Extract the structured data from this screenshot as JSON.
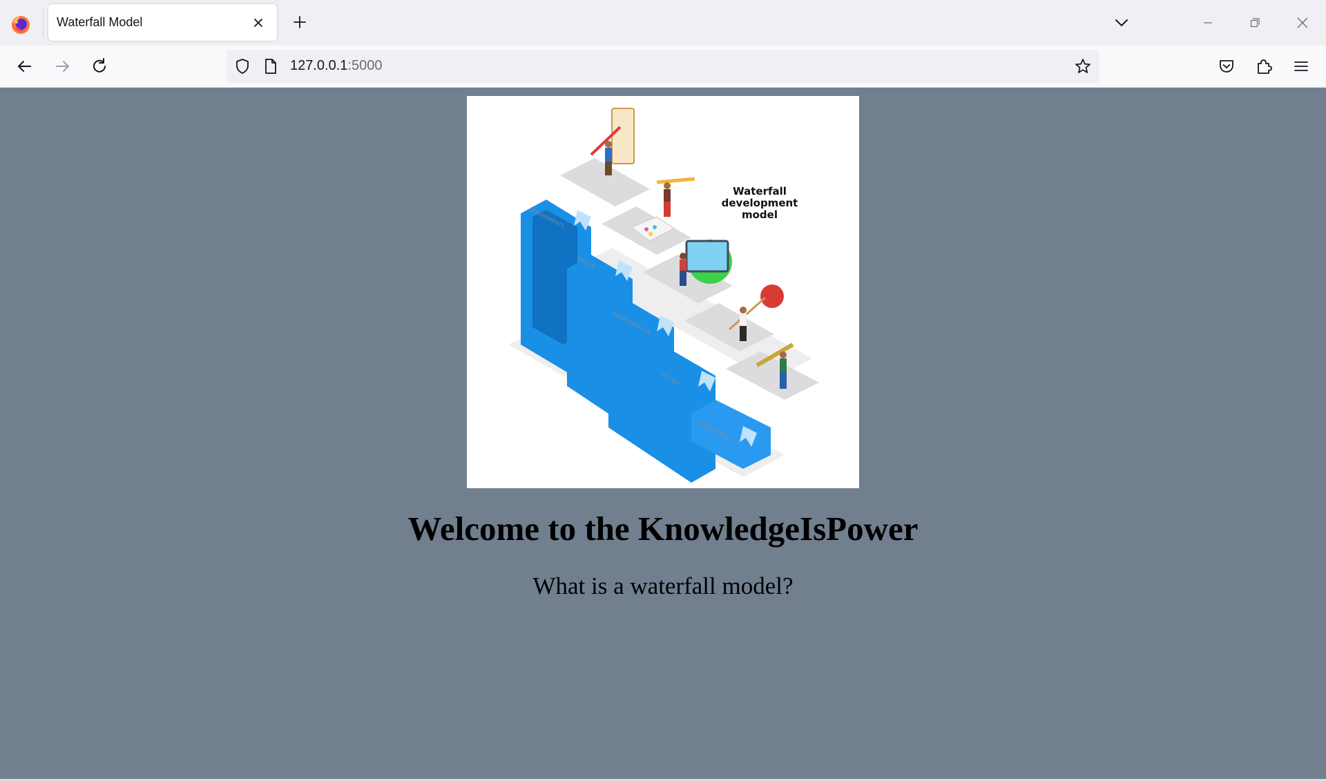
{
  "browser": {
    "tab_title": "Waterfall Model",
    "url_host": "127.0.0.1",
    "url_port": ":5000",
    "icons": [
      "firefox-logo",
      "close-icon",
      "plus-icon",
      "chevron-down-icon",
      "minimize-icon",
      "restore-icon",
      "close-window-icon",
      "back-arrow-icon",
      "forward-arrow-icon",
      "reload-icon",
      "shield-icon",
      "page-icon",
      "star-icon",
      "pocket-icon",
      "extensions-icon",
      "menu-icon"
    ]
  },
  "hero": {
    "caption": [
      "Waterfall",
      "development",
      "model"
    ],
    "stages": [
      "REQUIREMENTS",
      "DESIGN",
      "IMPLEMENTATION",
      "TESTING",
      "MAINTENANCE"
    ],
    "accent": "#1a8fe6"
  },
  "page": {
    "heading": "Welcome to the KnowledgeIsPower",
    "question": "What is a waterfall model?",
    "background": "#717f8f"
  }
}
